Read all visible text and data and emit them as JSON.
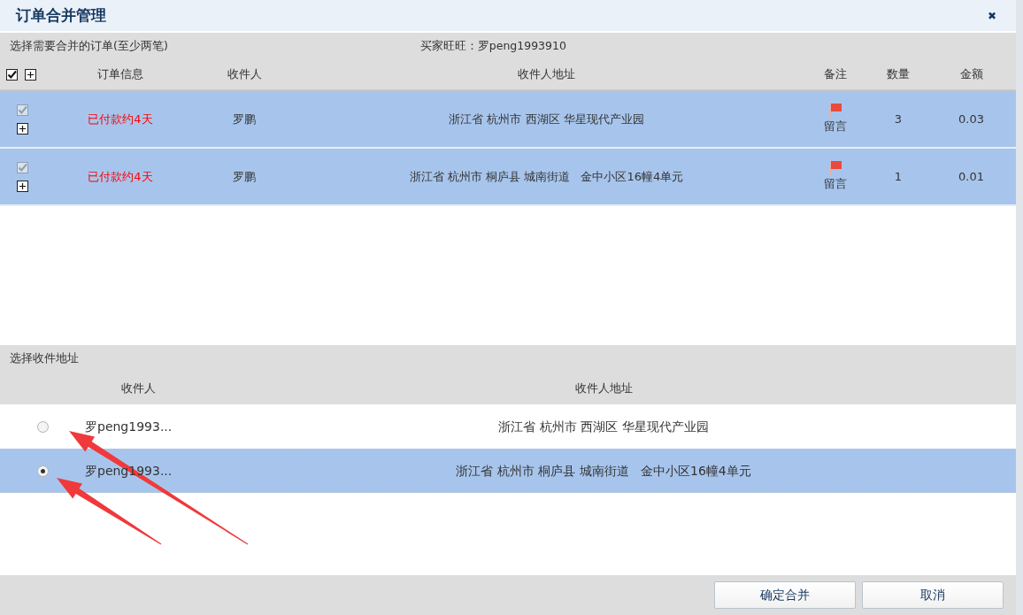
{
  "window": {
    "title": "订单合并管理",
    "close": "✖"
  },
  "orders": {
    "label": "选择需要合并的订单(至少两笔)",
    "buyer": "买家旺旺：罗peng1993910",
    "select_all_checked": true,
    "columns": [
      "订单信息",
      "收件人",
      "收件人地址",
      "备注",
      "数量",
      "金额"
    ],
    "rows": [
      {
        "checked": true,
        "disabled": true,
        "selected": true,
        "status": "已付款约4天",
        "receiver": "罗鹏",
        "address": "浙江省 杭州市 西湖区 华星现代产业园",
        "note": "留言",
        "quantity": "3",
        "amount": "0.03"
      },
      {
        "checked": true,
        "disabled": true,
        "selected": true,
        "status": "已付款约4天",
        "receiver": "罗鹏",
        "address": "浙江省 杭州市 桐庐县 城南街道   金中小区16幢4单元",
        "note": "留言",
        "quantity": "1",
        "amount": "0.01"
      }
    ]
  },
  "addresses": {
    "label": "选择收件地址",
    "columns": [
      "收件人",
      "收件人地址"
    ],
    "rows": [
      {
        "selected": false,
        "receiver": "罗peng1993...",
        "address": "浙江省 杭州市 西湖区 华星现代产业园"
      },
      {
        "selected": true,
        "receiver": "罗peng1993...",
        "address": "浙江省 杭州市 桐庐县 城南街道   金中小区16幢4单元"
      }
    ]
  },
  "buttons": [
    "确定合并",
    "取消"
  ]
}
